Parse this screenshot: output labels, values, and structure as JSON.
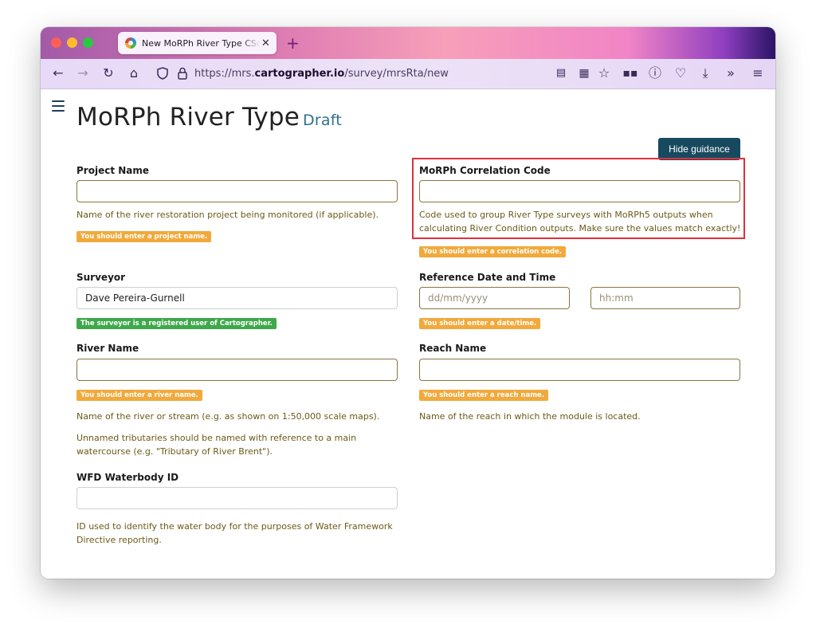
{
  "browser": {
    "tab_title": "New MoRPh River Type CSci - M",
    "url_prefix": "https://mrs.",
    "url_domain": "cartographer.io",
    "url_path": "/survey/mrsRta/new"
  },
  "page": {
    "title": "MoRPh River Type",
    "status": "Draft",
    "guidance_button": "Hide guidance"
  },
  "fields": {
    "project_name": {
      "label": "Project Name",
      "value": "",
      "guidance": "Name of the river restoration project being monitored (if applicable).",
      "message": "You should enter a project name."
    },
    "correlation_code": {
      "label": "MoRPh Correlation Code",
      "value": "",
      "guidance_line1": "Code used to group River Type surveys with MoRPh5 outputs when",
      "guidance_line2": "calculating River Condition outputs. Make sure the values match exactly!",
      "message": "You should enter a correlation code."
    },
    "surveyor": {
      "label": "Surveyor",
      "value": "Dave Pereira-Gurnell",
      "message": "The surveyor is a registered user of Cartographer."
    },
    "reference_date": {
      "label": "Reference Date and Time",
      "date_placeholder": "dd/mm/yyyy",
      "time_placeholder": "hh:mm",
      "message": "You should enter a date/time."
    },
    "river_name": {
      "label": "River Name",
      "value": "",
      "message": "You should enter a river name.",
      "guidance1": "Name of the river or stream (e.g. as shown on 1:50,000 scale maps).",
      "guidance2_line1": "Unnamed tributaries should be named with reference to a main",
      "guidance2_line2": "watercourse (e.g. \"Tributary of River Brent\")."
    },
    "reach_name": {
      "label": "Reach Name",
      "value": "",
      "message": "You should enter a reach name.",
      "guidance": "Name of the reach in which the module is located."
    },
    "wfd_waterbody": {
      "label": "WFD Waterbody ID",
      "value": "",
      "guidance_line1": "ID used to identify the water body for the purposes of Water Framework",
      "guidance_line2": "Directive reporting."
    }
  },
  "colors": {
    "warning_badge": "#f2a93b",
    "success_badge": "#3ea84a",
    "guidance_text": "#6b5a17",
    "highlight": "#e0303c",
    "primary_button": "#174a5f"
  }
}
